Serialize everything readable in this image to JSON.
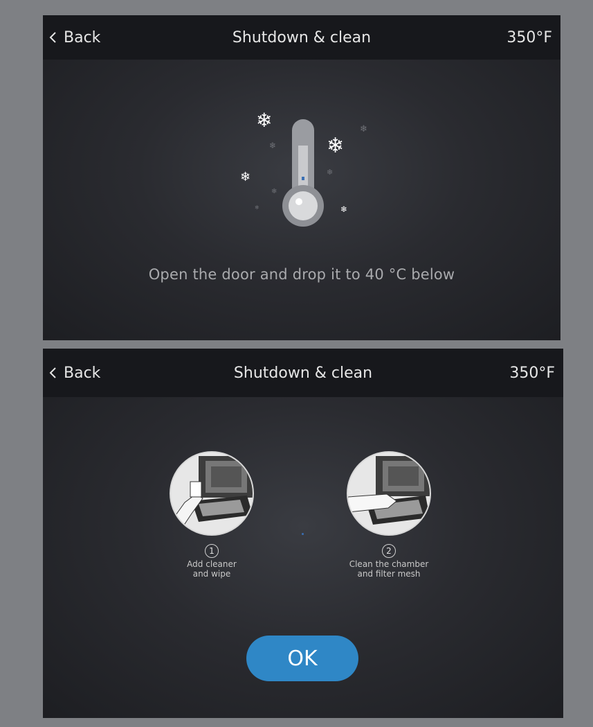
{
  "screens": [
    {
      "header": {
        "back_label": "Back",
        "title": "Shutdown & clean",
        "temperature": "350°F"
      },
      "message": "Open the door and drop it to 40 °C below"
    },
    {
      "header": {
        "back_label": "Back",
        "title": "Shutdown & clean",
        "temperature": "350°F"
      },
      "steps": [
        {
          "number": "1",
          "text": "Add cleaner\nand wipe"
        },
        {
          "number": "2",
          "text": "Clean the chamber\nand filter mesh"
        }
      ],
      "ok_label": "OK"
    }
  ],
  "colors": {
    "header_bg": "#17181c",
    "accent": "#2f87c6",
    "page_bg": "#7e8084"
  },
  "icons": [
    "chevron-left-icon",
    "thermometer-icon",
    "snowflake-icon"
  ]
}
